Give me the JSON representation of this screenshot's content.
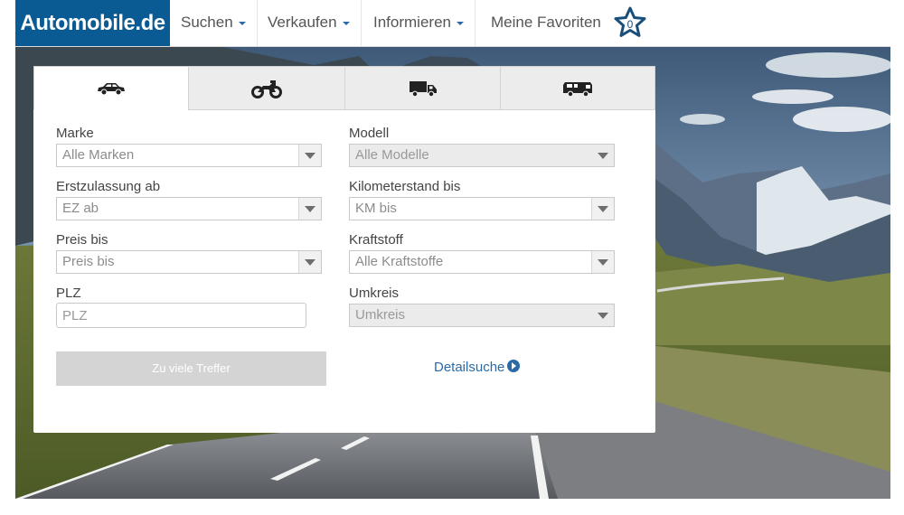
{
  "header": {
    "logo": "Automobile.de",
    "nav": [
      {
        "label": "Suchen",
        "dropdown": true
      },
      {
        "label": "Verkaufen",
        "dropdown": true
      },
      {
        "label": "Informieren",
        "dropdown": true
      }
    ],
    "favorites_label": "Meine Favoriten",
    "favorites_count": "0"
  },
  "colors": {
    "brand": "#0a5a93",
    "link": "#2a6aa6",
    "button_disabled": "#d4d4d4"
  },
  "search": {
    "vehicle_tabs": [
      {
        "icon": "car-icon",
        "active": true
      },
      {
        "icon": "motorcycle-icon",
        "active": false
      },
      {
        "icon": "truck-icon",
        "active": false
      },
      {
        "icon": "camper-icon",
        "active": false
      }
    ],
    "fields": {
      "make": {
        "label": "Marke",
        "value": "Alle Marken",
        "disabled": false
      },
      "model": {
        "label": "Modell",
        "value": "Alle Modelle",
        "disabled": true
      },
      "first_registration": {
        "label": "Erstzulassung ab",
        "value": "EZ ab",
        "disabled": false
      },
      "mileage": {
        "label": "Kilometerstand bis",
        "value": "KM bis",
        "disabled": false
      },
      "price": {
        "label": "Preis bis",
        "value": "Preis bis",
        "disabled": false
      },
      "fuel": {
        "label": "Kraftstoff",
        "value": "Alle Kraftstoffe",
        "disabled": false
      },
      "zip": {
        "label": "PLZ",
        "placeholder": "PLZ",
        "value": ""
      },
      "radius": {
        "label": "Umkreis",
        "value": "Umkreis",
        "disabled": true
      }
    },
    "submit_label": "Zu viele Treffer",
    "detail_search_label": "Detailsuche"
  }
}
